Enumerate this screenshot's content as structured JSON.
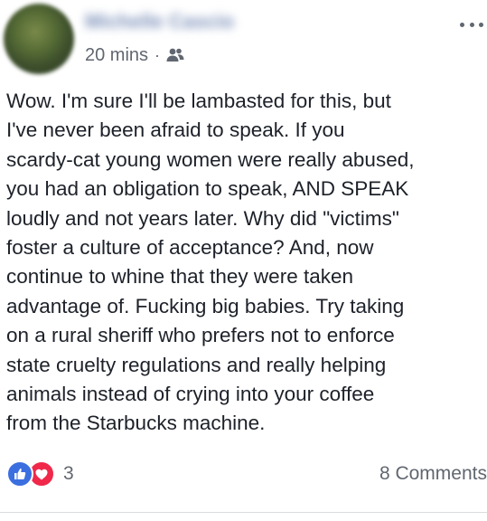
{
  "post": {
    "author_name": "Michelle Cascio",
    "timestamp": "20 mins",
    "separator": "·",
    "audience_icon": "friends-icon",
    "more_icon": "more-options-icon",
    "text": "Wow.  I'm sure I'll be lambasted for this, but I've never been afraid to speak.  If you scardy-cat young women were really abused, you had an obligation to speak, AND SPEAK loudly and not years later.  Why did \"victims\" foster a culture of acceptance?  And, now continue to whine that they were taken advantage of.  Fucking big babies.  Try taking on a rural sheriff who prefers not to enforce state cruelty regulations and really helping animals instead of crying into your coffee from the Starbucks machine.",
    "text_lines": [
      "Wow.  I'm sure I'll be lambasted for this, but",
      "I've never been afraid to speak.  If you",
      "scardy-cat young women were really abused,",
      "you had an obligation to speak, AND SPEAK",
      "loudly and not years later.  Why did \"victims\"",
      "foster a culture of acceptance?  And, now",
      "continue to whine that they were taken",
      "advantage of.  Fucking big babies.  Try taking",
      "on a rural sheriff who prefers not to enforce",
      "state cruelty regulations and really helping",
      "animals instead of crying into your coffee",
      "from the Starbucks machine."
    ]
  },
  "footer": {
    "reactions": [
      "like-icon",
      "love-icon"
    ],
    "reaction_count": "3",
    "comments_label": "8 Comments"
  },
  "colors": {
    "text": "#1d2129",
    "meta": "#616770",
    "like": "#3b6fe0",
    "love": "#f0284a",
    "divider": "#dadde1"
  }
}
